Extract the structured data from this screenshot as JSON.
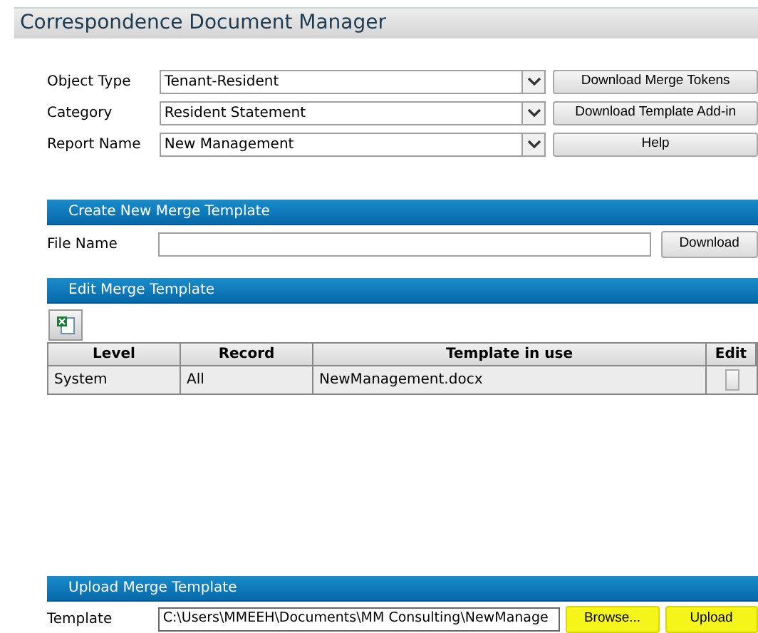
{
  "title": "Correspondence Document Manager",
  "selectors": [
    {
      "label": "Object Type",
      "value": "Tenant-Resident",
      "button": "Download Merge Tokens"
    },
    {
      "label": "Category",
      "value": "Resident Statement",
      "button": "Download Template Add-in"
    },
    {
      "label": "Report Name",
      "value": "New Management",
      "button": "Help"
    }
  ],
  "create_section": {
    "title": "Create New Merge Template",
    "field_label": "File Name",
    "button": "Download"
  },
  "edit_section": {
    "title": "Edit Merge Template",
    "table": {
      "columns": [
        "Level",
        "Record",
        "Template in use",
        "Edit"
      ],
      "rows": [
        {
          "cells": [
            "System",
            "All",
            "NewManagement.docx"
          ]
        }
      ]
    }
  },
  "upload_section": {
    "title": "Upload Merge Template",
    "field_label": "Template",
    "value": "C:\\Users\\MMEEH\\Documents\\MM Consulting\\NewManage",
    "buttons": [
      {
        "label": "Browse...",
        "highlighted": true
      },
      {
        "label": "Upload",
        "highlighted": true
      }
    ]
  }
}
